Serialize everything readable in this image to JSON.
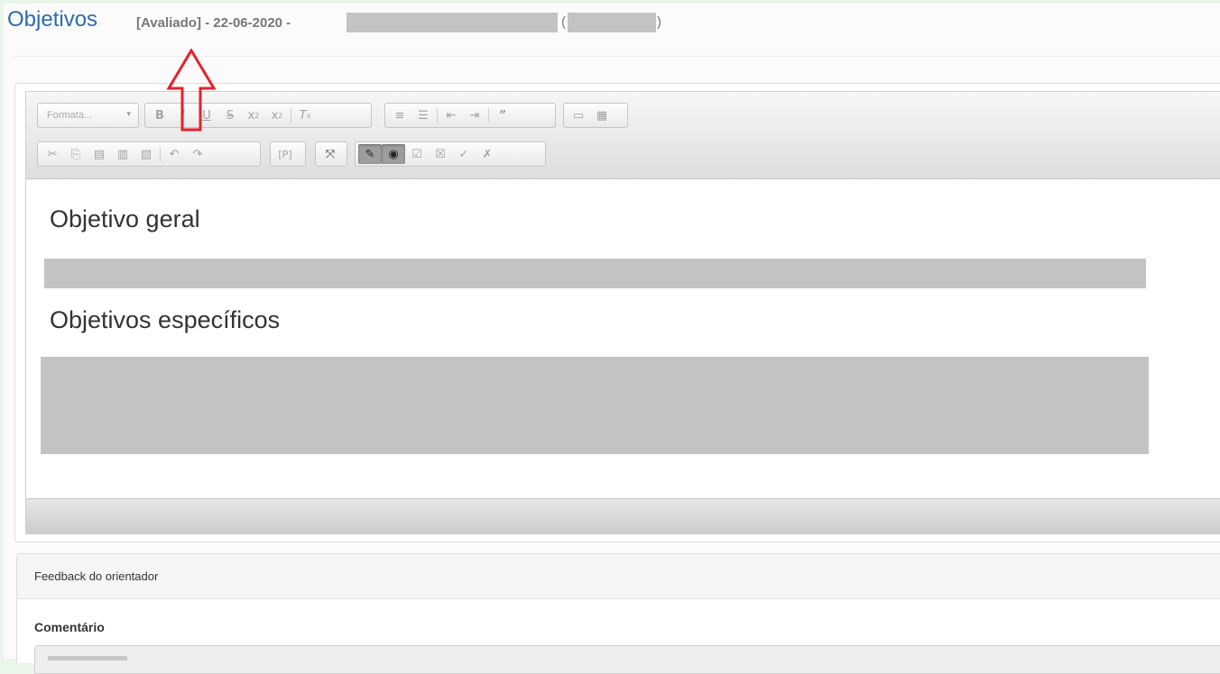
{
  "header": {
    "title": "Objetivos",
    "status": "[Avaliado] - 22-06-2020 -",
    "paren_open": "(",
    "paren_close": ")"
  },
  "toolbar": {
    "format_label": "Formata...",
    "row1": [
      "B",
      "I",
      "U",
      "S",
      "x₂",
      "x²",
      "Tx",
      "numbered-list",
      "bulleted-list",
      "outdent",
      "indent",
      "blockquote",
      "image",
      "table"
    ],
    "row2": [
      "cut",
      "copy",
      "paste",
      "paste-text",
      "paste-word",
      "undo",
      "redo",
      "[P]",
      "maximize",
      "spellcheck",
      "preview",
      "accept",
      "reject",
      "accept-all",
      "reject-all"
    ]
  },
  "editor": {
    "heading_general": "Objetivo geral",
    "heading_specific": "Objetivos específicos"
  },
  "feedback": {
    "panel_title": "Feedback do orientador",
    "comment_label": "Comentário"
  },
  "colors": {
    "title_blue": "#2b6bb1",
    "annotation_arrow": "#e8202a",
    "redaction_gray": "#c3c3c3"
  }
}
